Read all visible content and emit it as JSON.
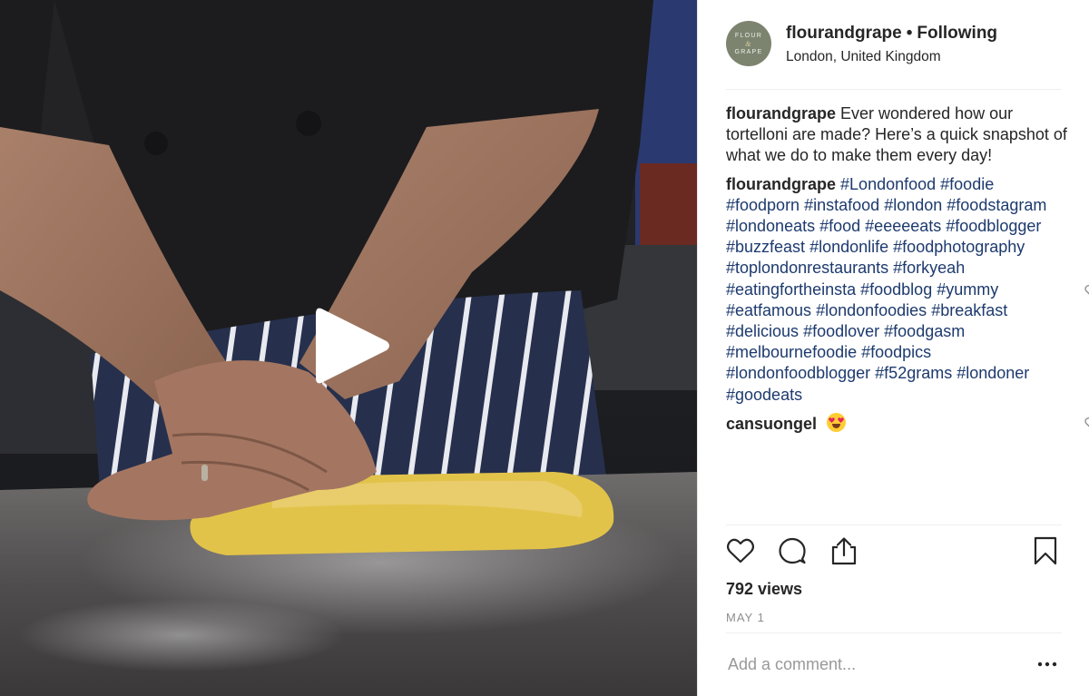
{
  "post": {
    "avatar": {
      "line1": "FLOUR",
      "amp": "&",
      "line2": "GRAPE"
    },
    "username": "flourandgrape",
    "separator": "•",
    "follow_status": "Following",
    "location": "London, United Kingdom"
  },
  "caption": {
    "user": "flourandgrape",
    "text": "Ever wondered how our tortelloni are made? Here’s a quick snapshot of what we do to make them every day!"
  },
  "hashtag_comment": {
    "user": "flourandgrape",
    "tags": [
      "#Londonfood",
      "#foodie",
      "#foodporn",
      "#instafood",
      "#london",
      "#foodstagram",
      "#londoneats",
      "#food",
      "#eeeeeats",
      "#foodblogger",
      "#buzzfeast",
      "#londonlife",
      "#foodphotography",
      "#toplondonrestaurants",
      "#forkyeah",
      "#eatingfortheinsta",
      "#foodblog",
      "#yummy",
      "#eatfamous",
      "#londonfoodies",
      "#breakfast",
      "#delicious",
      "#foodlover",
      "#foodgasm",
      "#melbournefoodie",
      "#foodpics",
      "#londonfoodblogger",
      "#f52grams",
      "#londoner",
      "#goodeats"
    ]
  },
  "reply": {
    "user": "cansuongel",
    "emoji_icon": "heart-eyes-emoji"
  },
  "stats": {
    "views": "792 views",
    "date": "MAY 1"
  },
  "comment_box": {
    "placeholder": "Add a comment..."
  },
  "icons": [
    "play-icon",
    "heart-icon",
    "comment-icon",
    "share-icon",
    "bookmark-icon",
    "more-options-icon"
  ],
  "colors": {
    "hashtag": "#1d3a6e",
    "secondary_text": "#8e8e8e",
    "divider": "#efefef",
    "avatar_bg": "#7c8470"
  }
}
